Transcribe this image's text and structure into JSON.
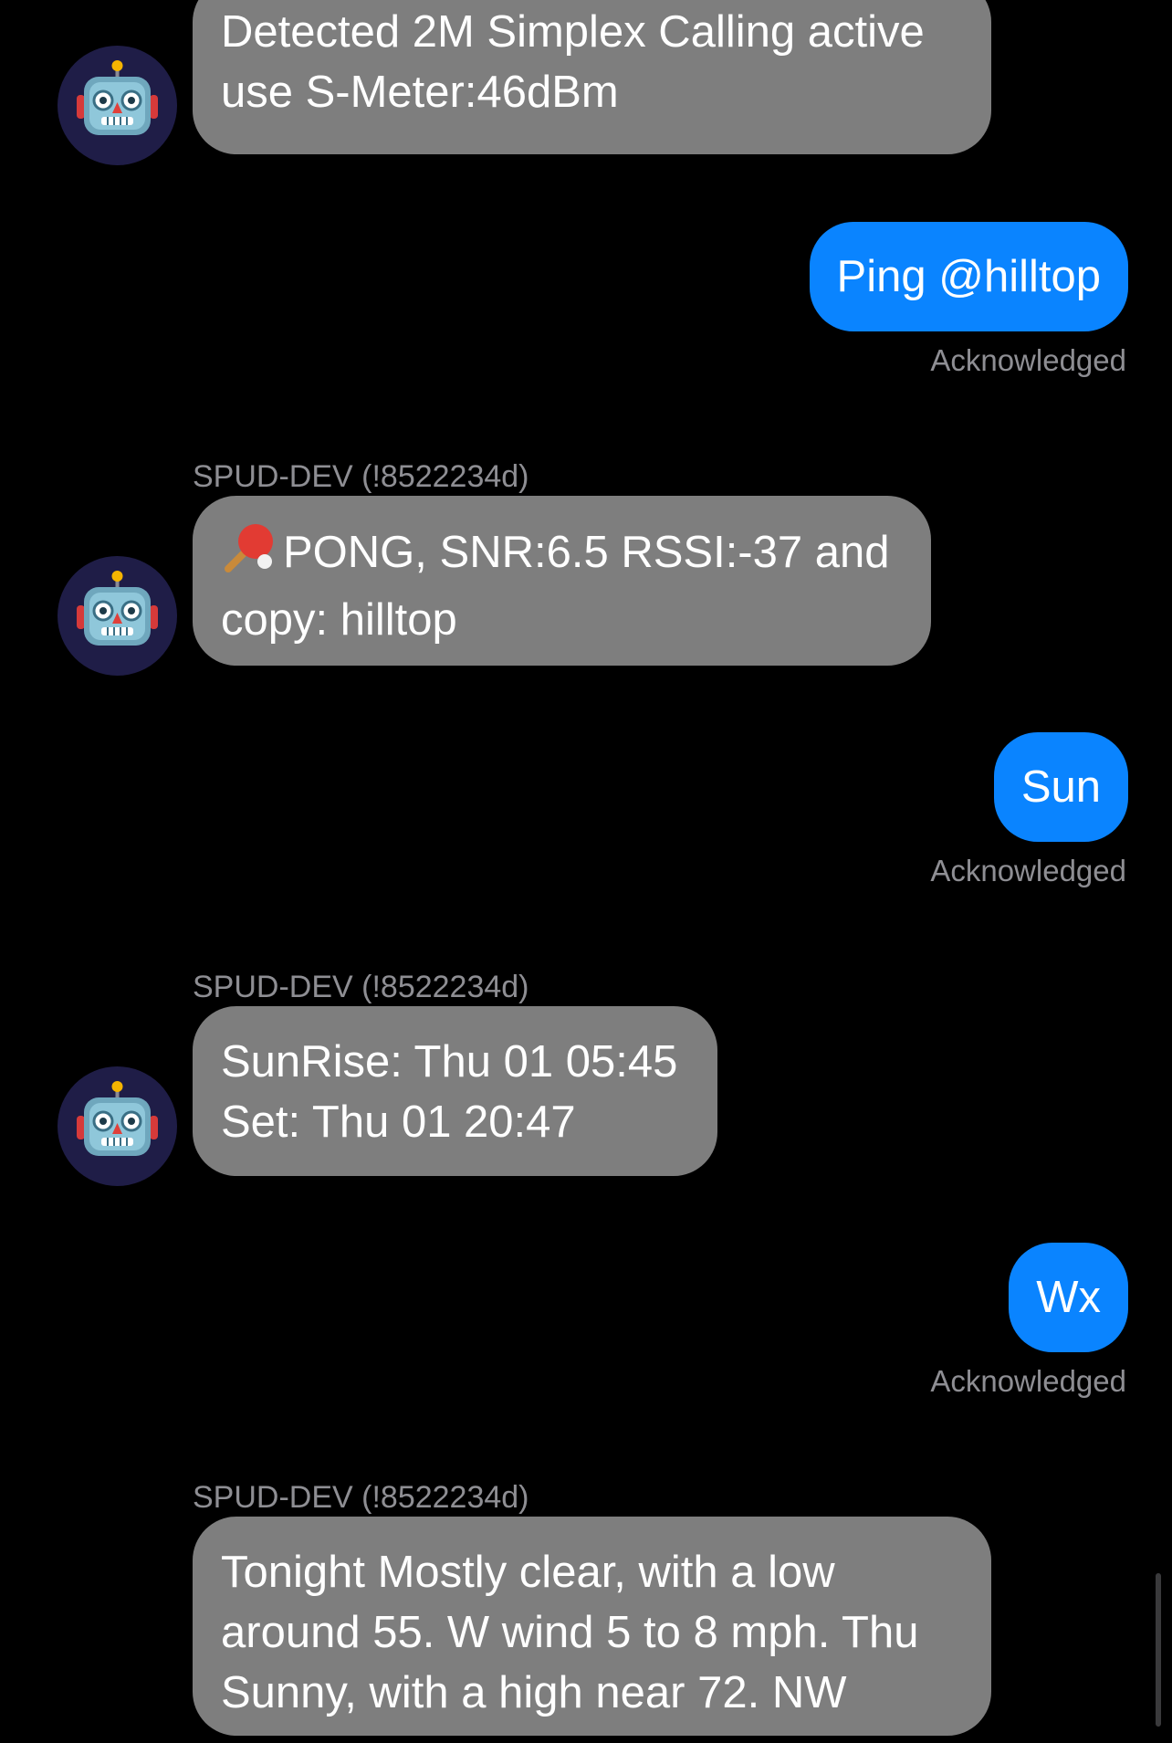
{
  "colors": {
    "background": "#000000",
    "incoming_bubble": "#7e7e7e",
    "outgoing_bubble": "#0a84ff",
    "meta_text": "#8e8e93",
    "avatar_bg": "#1f1d47"
  },
  "messages": [
    {
      "direction": "incoming",
      "avatar_icon": "robot-icon",
      "lines": [
        "Detected 2M Simplex Calling active",
        "use S-Meter:46dBm"
      ]
    },
    {
      "direction": "outgoing",
      "text": "Ping @hilltop",
      "status": "Acknowledged"
    },
    {
      "direction": "incoming",
      "sender": "SPUD-DEV (!8522234d)",
      "avatar_icon": "robot-icon",
      "prefix_icon": "ping-pong-icon",
      "lines": [
        "PONG, SNR:6.5 RSSI:-37 and",
        "copy: hilltop"
      ]
    },
    {
      "direction": "outgoing",
      "text": "Sun",
      "status": "Acknowledged"
    },
    {
      "direction": "incoming",
      "sender": "SPUD-DEV (!8522234d)",
      "avatar_icon": "robot-icon",
      "lines": [
        "SunRise: Thu 01 05:45",
        "Set: Thu 01 20:47"
      ]
    },
    {
      "direction": "outgoing",
      "text": "Wx",
      "status": "Acknowledged"
    },
    {
      "direction": "incoming",
      "sender": "SPUD-DEV (!8522234d)",
      "lines": [
        "Tonight Mostly clear, with a low",
        "around 55. W wind 5 to 8 mph. Thu",
        "Sunny, with a high near 72. NW"
      ]
    }
  ]
}
